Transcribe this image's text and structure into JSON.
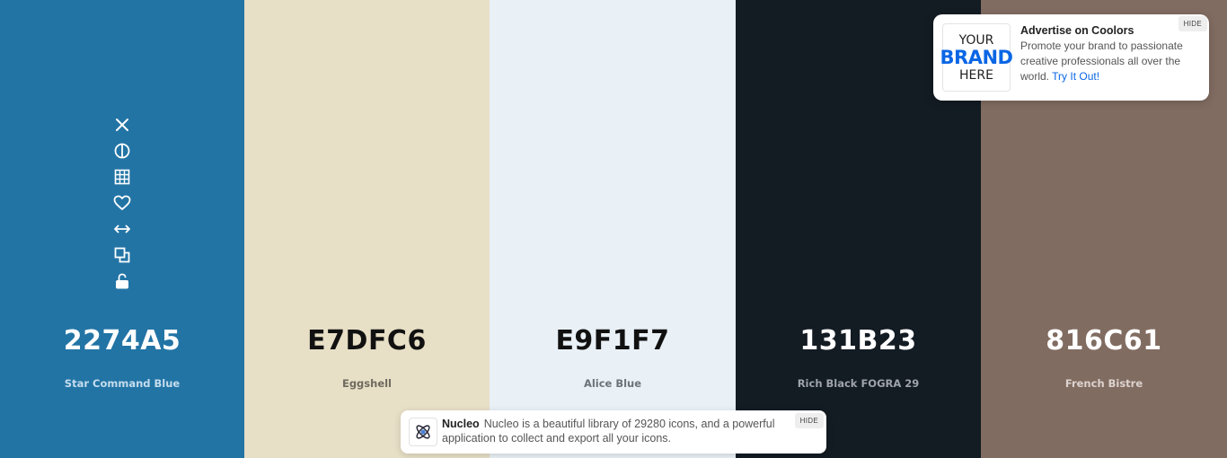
{
  "palette": [
    {
      "hex": "2274A5",
      "name": "Star Command Blue",
      "bg": "#2274A5",
      "text_color": "#ffffff",
      "name_color": "#c5ddee"
    },
    {
      "hex": "E7DFC6",
      "name": "Eggshell",
      "bg": "#E7DFC6",
      "text_color": "#111111",
      "name_color": "#6e6a5e"
    },
    {
      "hex": "E9F1F7",
      "name": "Alice Blue",
      "bg": "#E9F1F7",
      "text_color": "#111111",
      "name_color": "#6b7278"
    },
    {
      "hex": "131B23",
      "name": "Rich Black FOGRA 29",
      "bg": "#131B23",
      "text_color": "#ffffff",
      "name_color": "#9ea4aa"
    },
    {
      "hex": "816C61",
      "name": "French Bistre",
      "bg": "#816C61",
      "text_color": "#ffffff",
      "name_color": "#ddd3ce"
    }
  ],
  "toolbar_icons": [
    "close-icon",
    "contrast-icon",
    "grid-icon",
    "heart-icon",
    "drag-arrows-icon",
    "copy-icon",
    "unlock-icon"
  ],
  "ad": {
    "logo_line1": "YOUR",
    "logo_line2": "BRAND",
    "logo_line3": "HERE",
    "title": "Advertise on Coolors",
    "body": "Promote your brand to passionate creative professionals all over the world.",
    "link": "Try It Out!",
    "hide": "HIDE"
  },
  "nucleo": {
    "title": "Nucleo",
    "body": "Nucleo is a beautiful library of 29280 icons, and a powerful application to collect and export all your icons.",
    "hide": "HIDE",
    "icon": "atom-icon"
  }
}
